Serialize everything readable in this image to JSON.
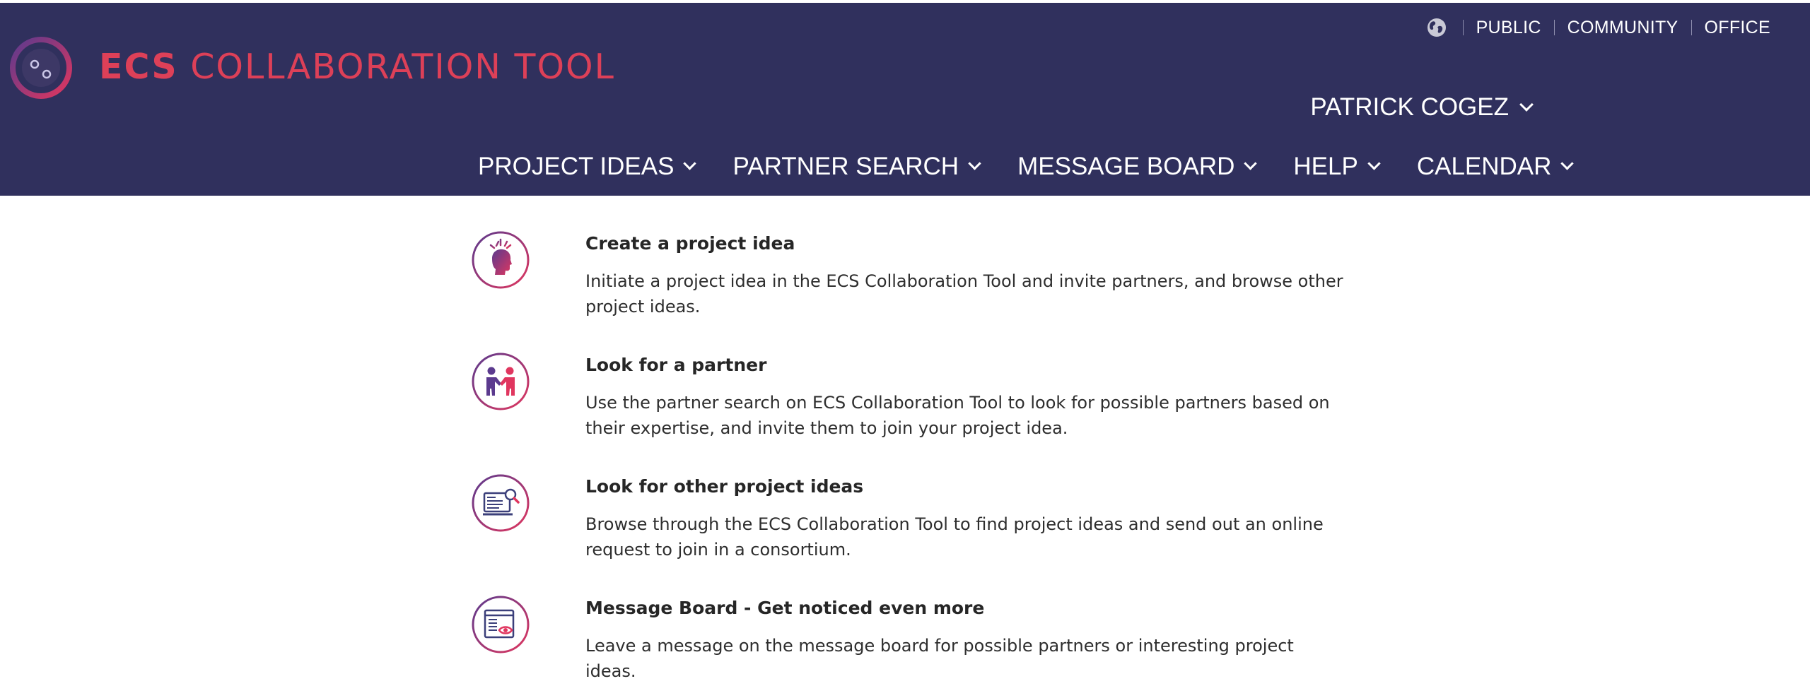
{
  "header": {
    "logo_bold": "ECS",
    "logo_rest": "COLLABORATION TOOL",
    "utility_links": [
      "PUBLIC",
      "COMMUNITY",
      "OFFICE"
    ],
    "user_name": "PATRICK COGEZ"
  },
  "nav": {
    "items": [
      "PROJECT IDEAS",
      "PARTNER SEARCH",
      "MESSAGE BOARD",
      "HELP",
      "CALENDAR"
    ]
  },
  "features": [
    {
      "icon": "head-ideas-icon",
      "title": "Create a project idea",
      "description": "Initiate a project idea in the ECS Collaboration Tool and invite partners, and browse other project ideas."
    },
    {
      "icon": "handshake-partners-icon",
      "title": "Look for a partner",
      "description": "Use the partner search on ECS Collaboration Tool to look for possible partners based on their expertise, and invite them to join your project idea."
    },
    {
      "icon": "search-document-icon",
      "title": "Look for other project ideas",
      "description": "Browse through the ECS Collaboration Tool to find project ideas and send out an online request to join in a consortium."
    },
    {
      "icon": "message-board-icon",
      "title": "Message Board - Get noticed even more",
      "description": "Leave a message on the message board for possible partners or interesting project ideas."
    }
  ],
  "colors": {
    "header_bg": "#30305d",
    "brand_red": "#dd4058",
    "icon_gradient_start": "#5b3a8e",
    "icon_gradient_end": "#e0365f"
  }
}
